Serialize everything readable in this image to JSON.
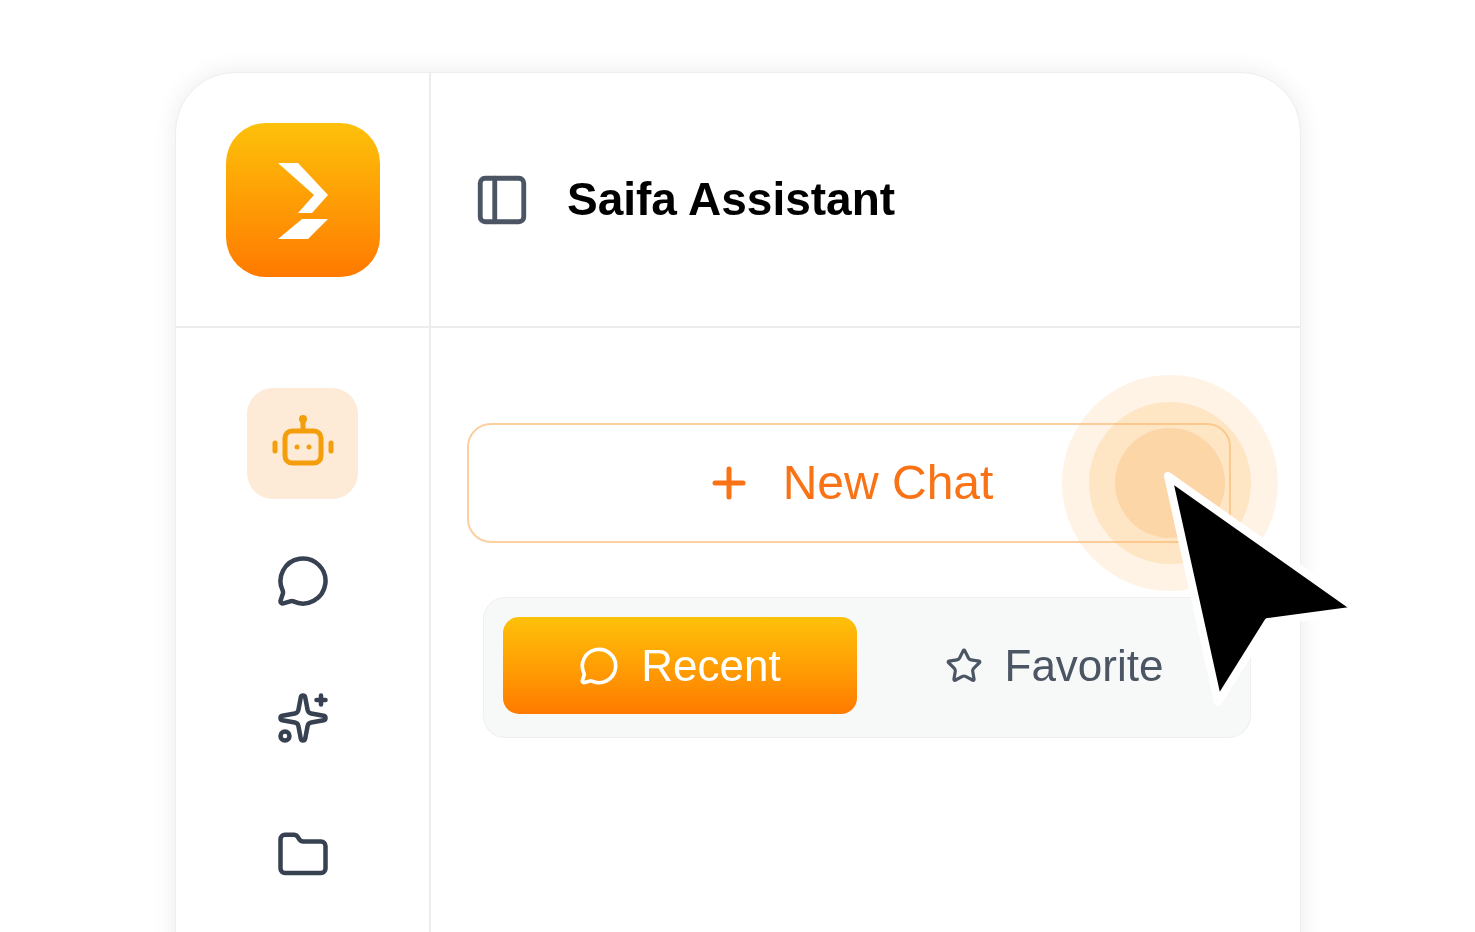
{
  "header": {
    "title": "Saifa Assistant"
  },
  "sidebar": {
    "items": [
      {
        "kind": "robot",
        "selected": true
      },
      {
        "kind": "chat",
        "selected": false
      },
      {
        "kind": "sparkles",
        "selected": false
      },
      {
        "kind": "folder",
        "selected": false
      }
    ]
  },
  "new_chat": {
    "label": "New Chat"
  },
  "tabs": [
    {
      "kind": "chat",
      "label": "Recent",
      "selected": true
    },
    {
      "kind": "star",
      "label": "Favorite",
      "selected": false
    }
  ]
}
